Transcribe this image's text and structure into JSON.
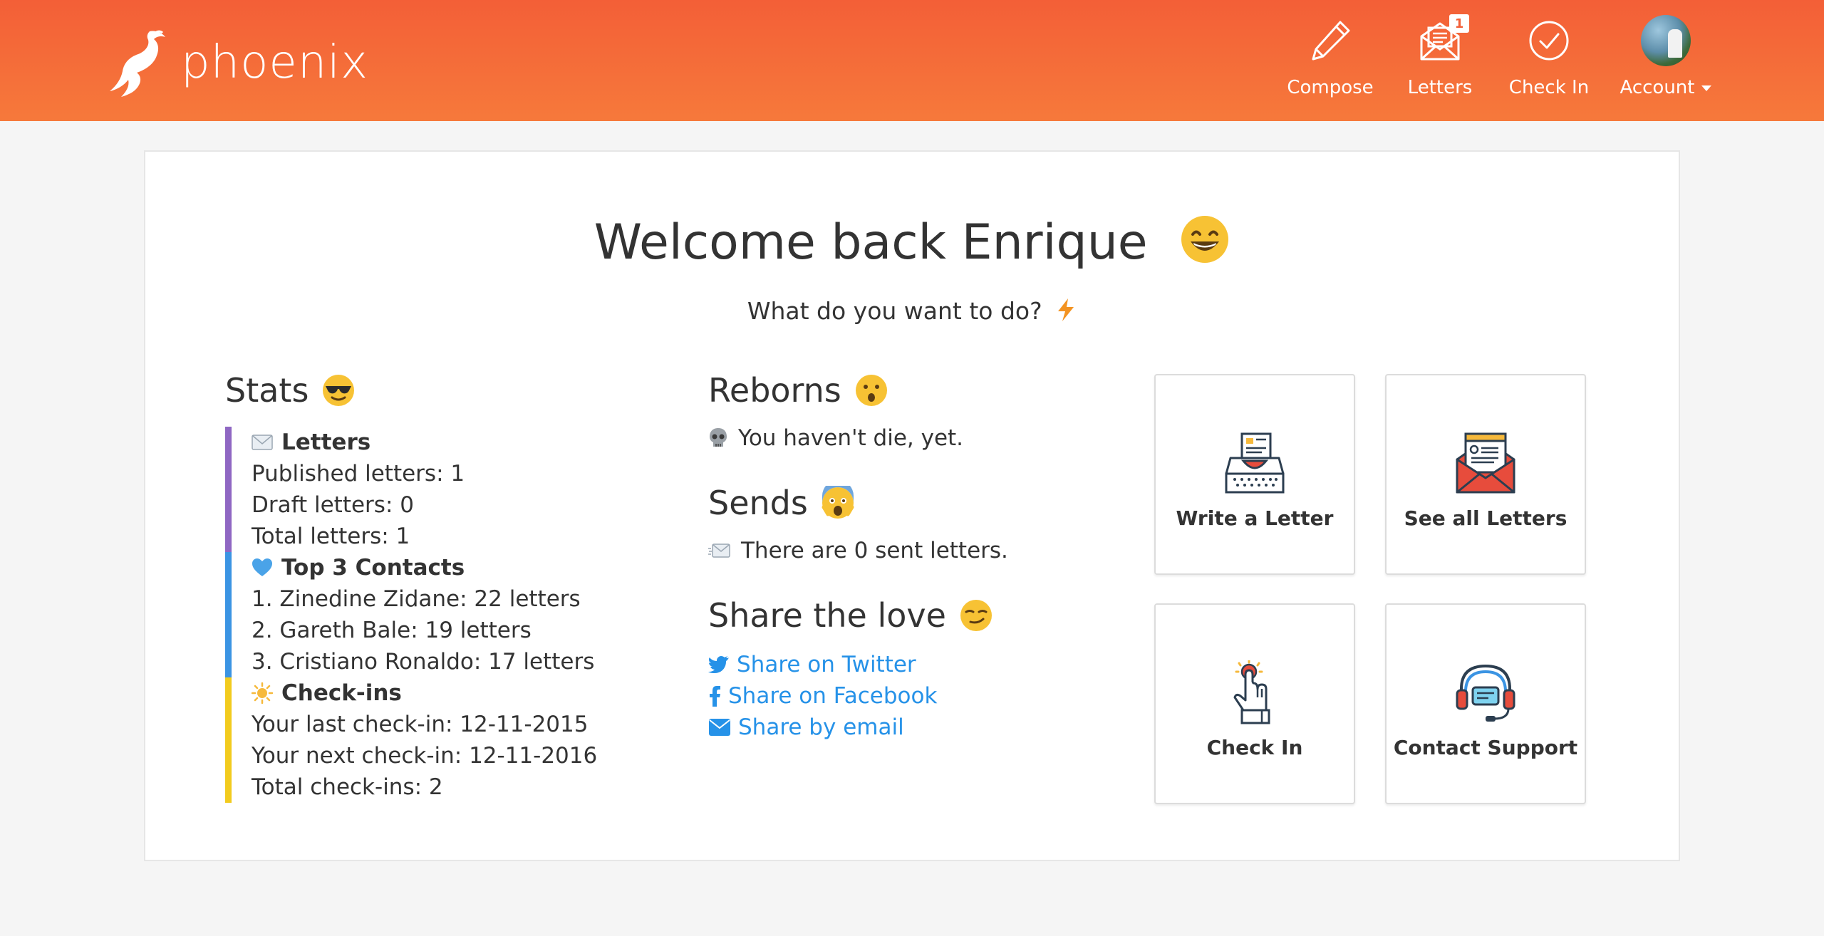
{
  "header": {
    "brand": "phoenix",
    "nav": {
      "compose": "Compose",
      "letters": "Letters",
      "letters_badge": "1",
      "checkin": "Check In",
      "account": "Account"
    }
  },
  "welcome": {
    "title": "Welcome back Enrique",
    "subtitle": "What do you want to do?"
  },
  "stats": {
    "heading": "Stats",
    "letters": {
      "heading": "Letters",
      "published": "Published letters: 1",
      "draft": "Draft letters: 0",
      "total": "Total letters: 1"
    },
    "contacts": {
      "heading": "Top 3 Contacts",
      "items": [
        "1. Zinedine Zidane: 22 letters",
        "2. Gareth Bale: 19 letters",
        "3. Cristiano Ronaldo: 17 letters"
      ]
    },
    "checkins": {
      "heading": "Check-ins",
      "last": "Your last check-in: 12-11-2015",
      "next": "Your next check-in: 12-11-2016",
      "total": "Total check-ins: 2"
    }
  },
  "reborns": {
    "heading": "Reborns",
    "text": "You haven't die, yet."
  },
  "sends": {
    "heading": "Sends",
    "text": "There are 0 sent letters."
  },
  "share": {
    "heading": "Share the love",
    "twitter": "Share on Twitter",
    "facebook": "Share on Facebook",
    "email": "Share by email"
  },
  "tiles": {
    "write": "Write a Letter",
    "see_all": "See all Letters",
    "checkin": "Check In",
    "support": "Contact Support"
  },
  "colors": {
    "header_top": "#f35f37",
    "header_bottom": "#f6793b",
    "letters_bar": "#8f67c3",
    "contacts_bar": "#3b94e3",
    "checkins_bar": "#f2cb1e",
    "link": "#2692e8"
  }
}
